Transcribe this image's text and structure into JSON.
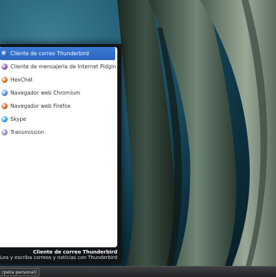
{
  "menu": {
    "items": [
      {
        "label": "Cliente de correo Thunderbird",
        "icon": "thunderbird-icon",
        "color": "#2e6fbf",
        "selected": true
      },
      {
        "label": "Cliente de mensajería de Internet Pidgin",
        "icon": "pidgin-icon",
        "color": "#8e5aa8",
        "selected": false
      },
      {
        "label": "HexChat",
        "icon": "hexchat-icon",
        "color": "#e07b1f",
        "selected": false
      },
      {
        "label": "Navegador web Chromium",
        "icon": "chromium-icon",
        "color": "#4a8fe0",
        "selected": false
      },
      {
        "label": "Navegador web Firefox",
        "icon": "firefox-icon",
        "color": "#e8641e",
        "selected": false
      },
      {
        "label": "Skype",
        "icon": "skype-icon",
        "color": "#2aa8e6",
        "selected": false
      },
      {
        "label": "Transmission",
        "icon": "transmission-icon",
        "color": "#9a8cc4",
        "selected": false
      }
    ],
    "selected_title": "Cliente de correo Thunderbird",
    "selected_description": "Lea y escriba correos y noticias con Thunderbird"
  },
  "taskbar": {
    "item_label": "rpeta personal]"
  },
  "colors": {
    "selection": "#2f6dca",
    "panel_bg": "#111417"
  }
}
